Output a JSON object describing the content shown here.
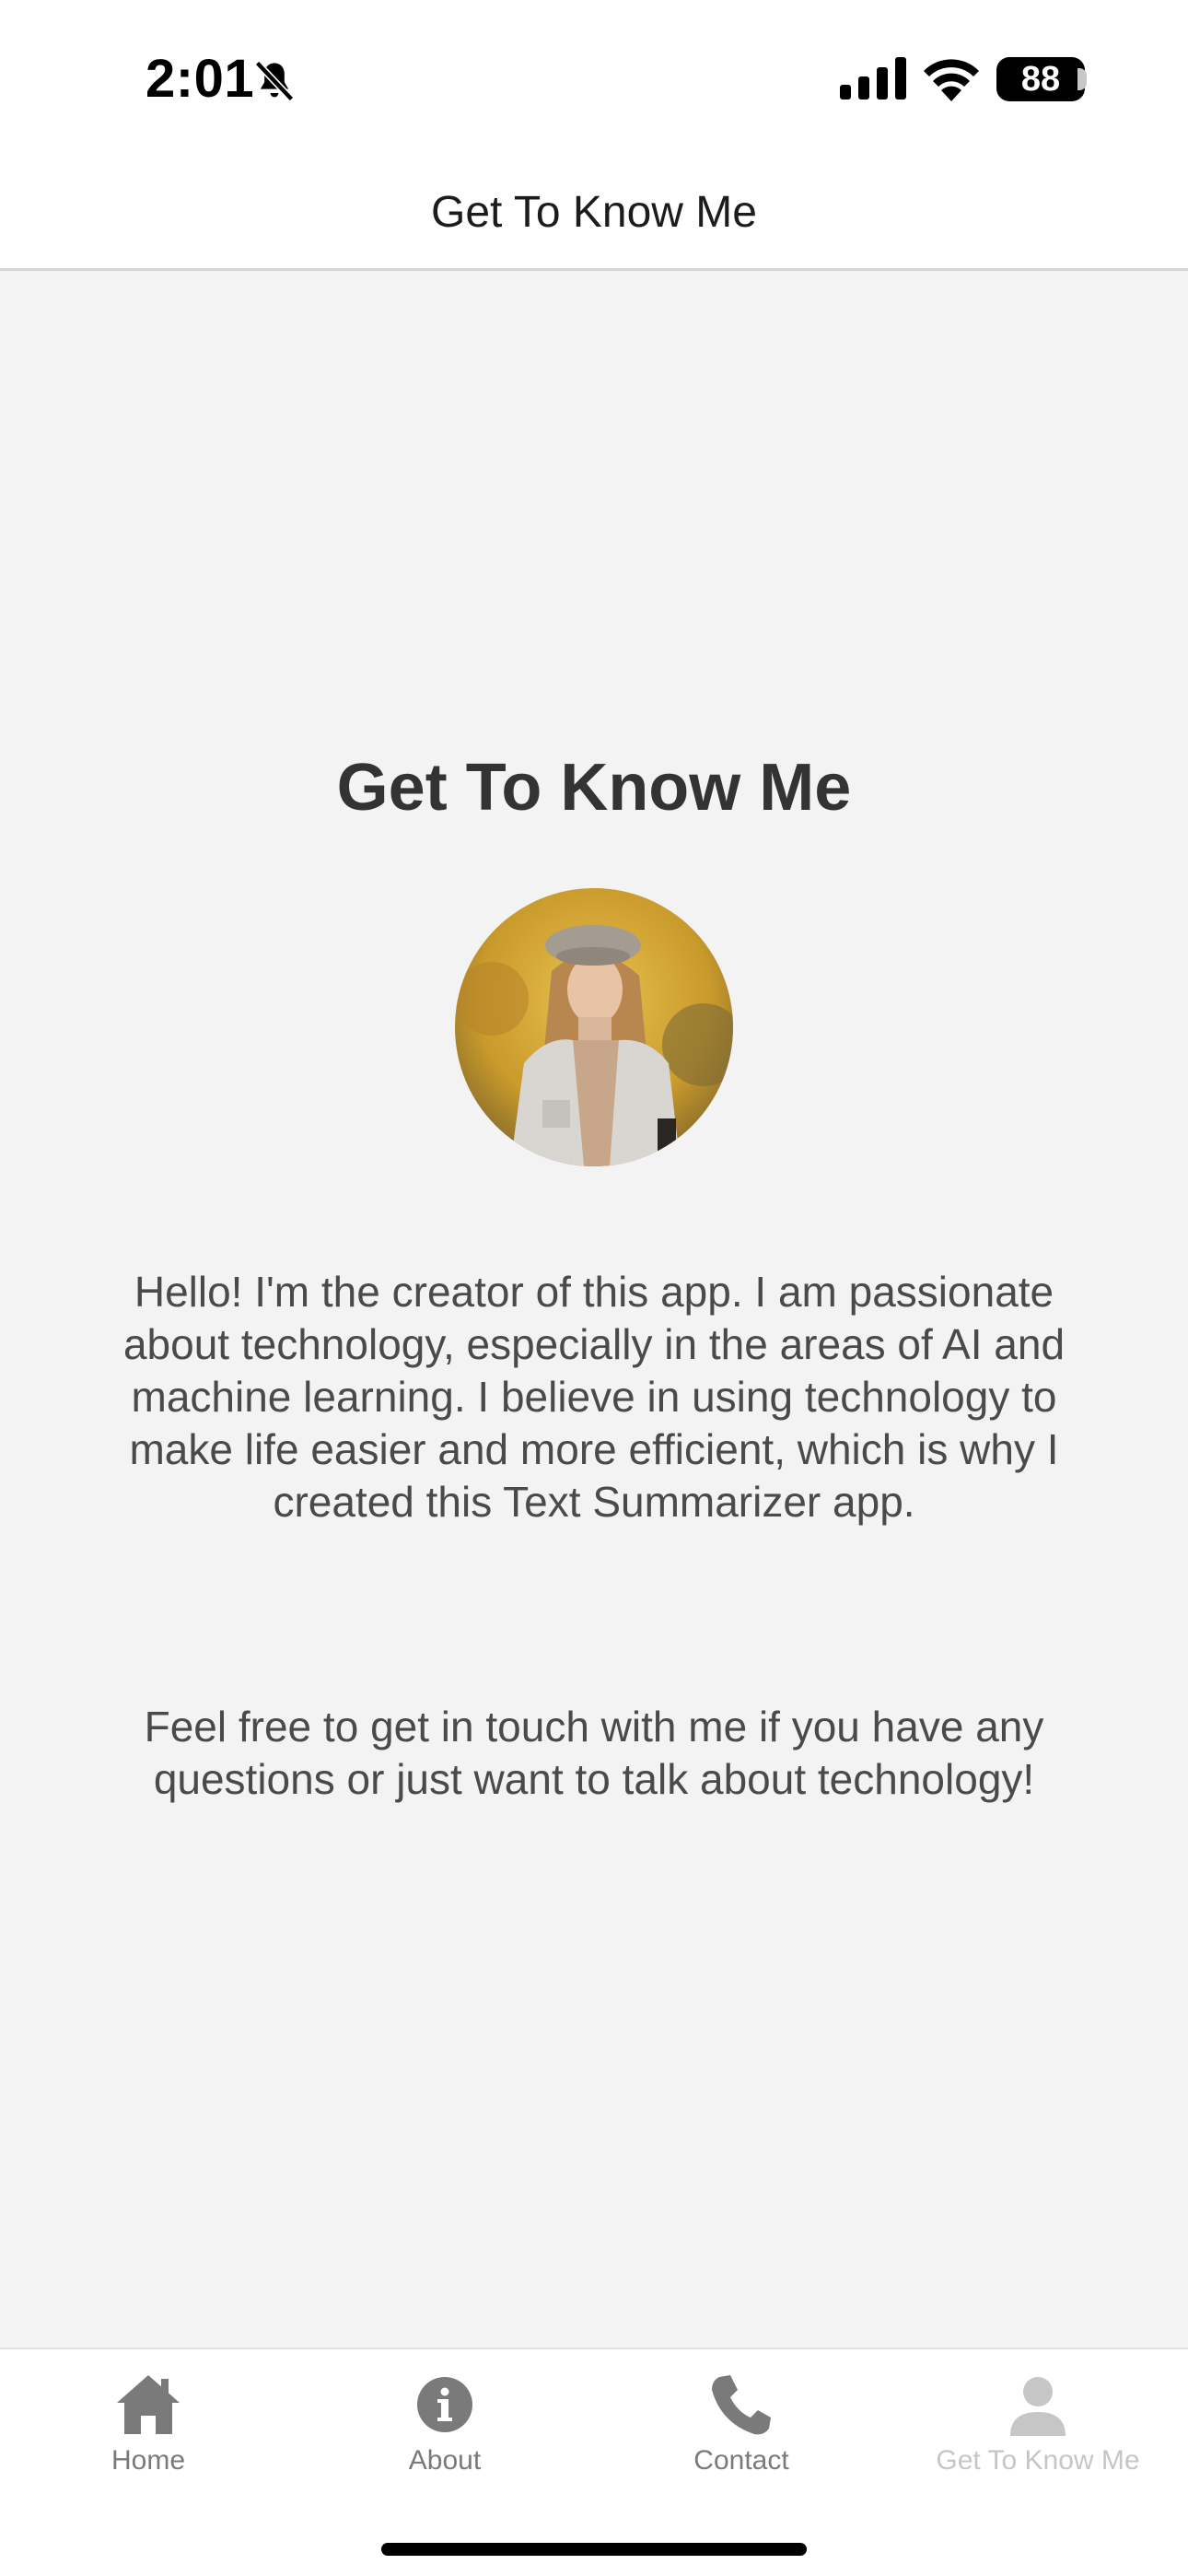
{
  "status_bar": {
    "time": "2:01",
    "battery": "88",
    "icons": [
      "bell-slash-icon",
      "cellular-signal-icon",
      "wifi-icon",
      "battery-icon"
    ]
  },
  "header": {
    "title": "Get To Know Me"
  },
  "main": {
    "heading": "Get To Know Me",
    "avatar": "profile-photo",
    "bio": "Hello! I'm the creator of this app. I am passionate about technology, especially in the areas of AI and machine learning. I believe in using technology to make life easier and more efficient, which is why I created this Text Summarizer app.",
    "contact_note": "Feel free to get in touch with me if you have any questions or just want to talk about technology!"
  },
  "tab_bar": {
    "tabs": [
      {
        "label": "Home",
        "icon": "home-icon",
        "active": false
      },
      {
        "label": "About",
        "icon": "info-icon",
        "active": false
      },
      {
        "label": "Contact",
        "icon": "phone-icon",
        "active": false
      },
      {
        "label": "Get To Know Me",
        "icon": "person-icon",
        "active": true
      }
    ]
  },
  "colors": {
    "background": "#f3f3f3",
    "text": "#4a4a4a",
    "heading": "#333333",
    "tab_inactive": "#7a7a7a",
    "tab_active": "#c6c6c6"
  }
}
